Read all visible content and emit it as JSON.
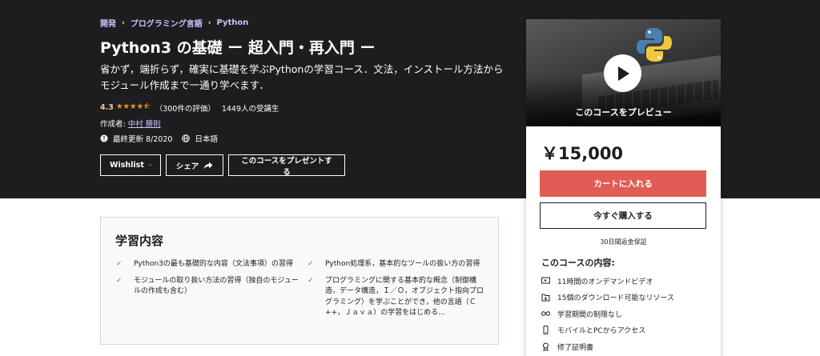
{
  "breadcrumb": {
    "items": [
      "開発",
      "プログラミング言語",
      "Python"
    ]
  },
  "course": {
    "title": "Python3 の基礎 ー 超入門・再入門 ー",
    "subtitle": "省かず，端折らず，確実に基礎を学ぶPythonの学習コース．文法，インストール方法からモジュール作成まで一通り学べます．",
    "rating": "4.3",
    "stars": "★★★★⯪",
    "rating_count": "（300件の評価）",
    "students": "1449人の受講生",
    "author_prefix": "作成者:",
    "author": "中村 勝則",
    "last_updated": "最終更新 8/2020",
    "language": "日本語"
  },
  "hero_buttons": {
    "wishlist": "Wishlist",
    "share": "シェア",
    "gift": "このコースをプレゼントする"
  },
  "sidebar": {
    "preview_label": "このコースをプレビュー",
    "price": "￥15,000",
    "cart_button": "カートに入れる",
    "buy_button": "今すぐ購入する",
    "guarantee": "30日間返金保証",
    "includes_title": "このコースの内容:",
    "includes": [
      {
        "icon": "video-icon",
        "text": "11時間のオンデマンドビデオ"
      },
      {
        "icon": "download-file-icon",
        "text": "15個のダウンロード可能なリソース"
      },
      {
        "icon": "infinity-icon",
        "text": "学習期間の制限なし"
      },
      {
        "icon": "mobile-icon",
        "text": "モバイルとPCからアクセス"
      },
      {
        "icon": "certificate-icon",
        "text": "修了証明書"
      }
    ]
  },
  "learn": {
    "title": "学習内容",
    "left": [
      "Python3の最も基礎的な内容（文法事項）の習得",
      "モジュールの取り扱い方法の習得（独自のモジュールの作成も含む）"
    ],
    "right": [
      "Python処理系，基本的なツールの扱い方の習得",
      "プログラミングに関する基本的な概念（制御構造，データ構造，Ｉ／Ｏ，オブジェクト指向プログラミング）を学ぶことができ，他の言語（Ｃ++，Ｊａｖａ）の学習をはじめる..."
    ]
  },
  "colors": {
    "hero_bg": "#1c1d1f",
    "link_purple": "#cec0fc",
    "rating_gold": "#f3ca8c",
    "star_orange": "#e59819",
    "cart_red": "#e05c55"
  }
}
